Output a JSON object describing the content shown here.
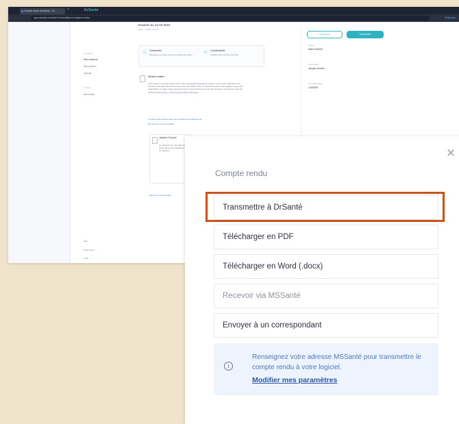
{
  "browser": {
    "tab_title": "Compte rendu d'examen - Dr",
    "url": "app.exemple-medical.fr/consultation/comptes-rendus",
    "ext_label": "Extension"
  },
  "app": {
    "brand": "DrSanté",
    "sidebar": {
      "section1": "Activité",
      "items": [
        "Mes examens",
        "Mes patients",
        "Agenda"
      ],
      "section2": "Outils",
      "items2": [
        "Mes textes"
      ],
      "footer": [
        "Aide",
        "Paramètres",
        "Profil"
      ]
    },
    "main": {
      "title": "Examen du 12.03.2024",
      "subtitle": "Créé · modifié à 14:12",
      "card1_title": "Transmettre",
      "card1_text": "Partagez le compte rendu au logiciel du patient",
      "card2_title": "Confidentialité",
      "card2_text": "Partagé via le service sécurisé",
      "comment_author": "Médecin traitant",
      "comment_text": "Lorem ipsum is simply dummy text of the printing and typesetting industry. Lorem ipsum has been the industry's standard dummy text ever since the 1500s, when an unknown printer took a galley of type and scrambled it to make a type specimen book. It has survived not only five centuries, but also the leap into electronic typesetting, remaining essentially unchanged.",
      "link1": "Compte rendu associé avec commentaire du professionnel",
      "link2": "Ne plus voir ce commentaire",
      "reply_author": "Jacques Dumont",
      "reply_text": "Il a toujours été important de suivre les recommandations du médecin.",
      "footer_link": "Ajouter un commentaire",
      "btn_outline": "Télécharger",
      "btn_primary": "Transmettre",
      "rp_labels": [
        "Patient",
        "Prescripteur",
        "N° de facturation"
      ],
      "rp_values": [
        "Marie DUBOIS",
        "Jacques Dumont",
        "12345678"
      ]
    }
  },
  "modal": {
    "title": "Compte rendu",
    "options": [
      "Transmettre à DrSanté",
      "Télécharger en PDF",
      "Télécharger en Word (.docx)",
      "Recevoir via MSSanté",
      "Envoyer à un correspondant"
    ],
    "info_text": "Renseignez votre adresse MSSanté pour transmettre le compte rendu à votre logiciel.",
    "info_link": "Modifier mes paramètres",
    "highlight_color": "#c9521e",
    "close_icon": "close-icon",
    "info_icon": "info-icon"
  }
}
